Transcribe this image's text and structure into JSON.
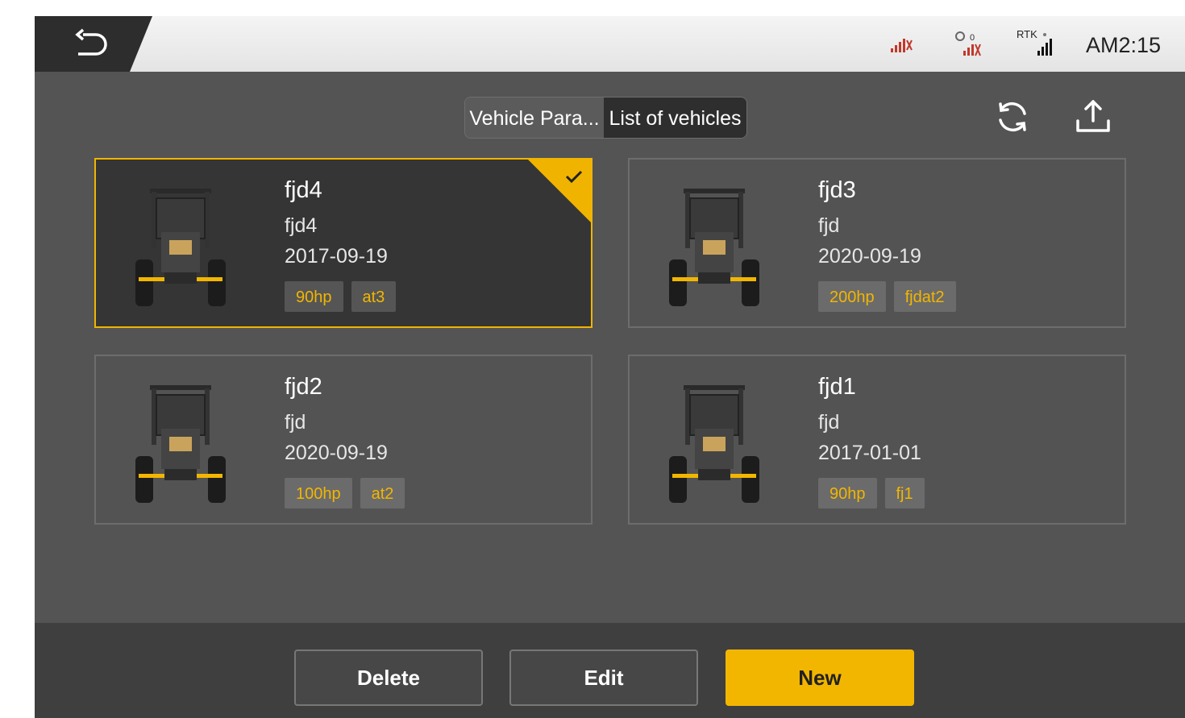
{
  "status_bar": {
    "rtk_label": "RTK",
    "time": "AM2:15"
  },
  "tabs": [
    {
      "label": "Vehicle Para...",
      "active": false
    },
    {
      "label": "List of vehicles",
      "active": true
    }
  ],
  "toolbar": {
    "refresh_icon": "refresh-icon",
    "upload_icon": "upload-icon"
  },
  "vehicles": [
    {
      "name": "fjd4",
      "model": "fjd4",
      "date": "2017-09-19",
      "tags": [
        "90hp",
        "at3"
      ],
      "selected": true
    },
    {
      "name": "fjd3",
      "model": "fjd",
      "date": "2020-09-19",
      "tags": [
        "200hp",
        "fjdat2"
      ],
      "selected": false
    },
    {
      "name": "fjd2",
      "model": "fjd",
      "date": "2020-09-19",
      "tags": [
        "100hp",
        "at2"
      ],
      "selected": false
    },
    {
      "name": "fjd1",
      "model": "fjd",
      "date": "2017-01-01",
      "tags": [
        "90hp",
        "fj1"
      ],
      "selected": false
    }
  ],
  "actions": {
    "delete_label": "Delete",
    "edit_label": "Edit",
    "new_label": "New"
  },
  "colors": {
    "accent": "#f3b600",
    "background": "#545454",
    "selected_card": "#353535"
  }
}
